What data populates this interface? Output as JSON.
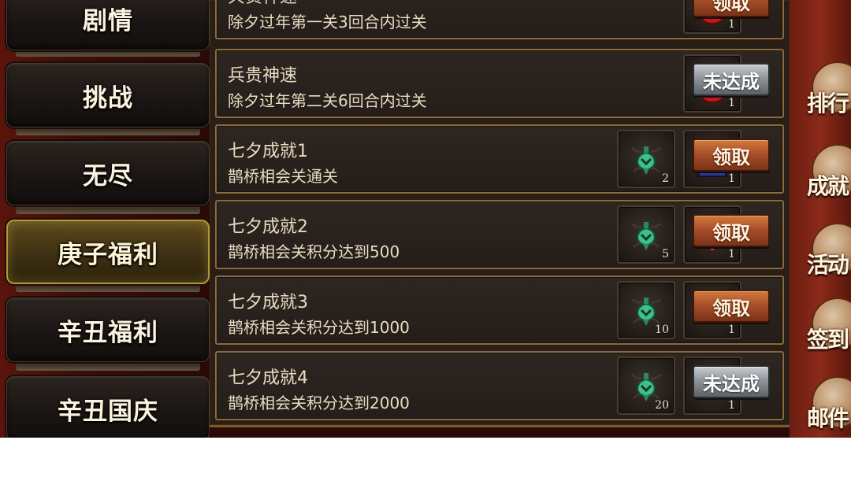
{
  "tabs": [
    {
      "label": "剧情",
      "active": false
    },
    {
      "label": "挑战",
      "active": false
    },
    {
      "label": "无尽",
      "active": false
    },
    {
      "label": "庚子福利",
      "active": true
    },
    {
      "label": "辛丑福利",
      "active": false
    },
    {
      "label": "辛丑国庆",
      "active": false
    }
  ],
  "rows": [
    {
      "title": "兵贵神速",
      "desc": "除夕过年第一关3回合内过关",
      "rewards": [
        {
          "icon": "red-pouch-icon",
          "count": "1"
        }
      ],
      "button": "领取",
      "claimable": true
    },
    {
      "title": "兵贵神速",
      "desc": "除夕过年第二关6回合内过关",
      "rewards": [
        {
          "icon": "red-pouch-icon",
          "count": "1"
        }
      ],
      "button": "未达成",
      "claimable": false
    },
    {
      "title": "七夕成就1",
      "desc": "鹊桥相会关通关",
      "rewards": [
        {
          "icon": "green-jade-icon",
          "count": "2"
        },
        {
          "icon": "warrior-avatar-icon",
          "count": "1"
        }
      ],
      "button": "领取",
      "claimable": true
    },
    {
      "title": "七夕成就2",
      "desc": "鹊桥相会关积分达到500",
      "rewards": [
        {
          "icon": "green-jade-icon",
          "count": "5"
        },
        {
          "icon": "heart-icon",
          "count": "1"
        }
      ],
      "button": "领取",
      "claimable": true
    },
    {
      "title": "七夕成就3",
      "desc": "鹊桥相会关积分达到1000",
      "rewards": [
        {
          "icon": "green-jade-icon",
          "count": "10"
        },
        {
          "icon": "red-book-icon",
          "count": "1"
        }
      ],
      "button": "领取",
      "claimable": true
    },
    {
      "title": "七夕成就4",
      "desc": "鹊桥相会关积分达到2000",
      "rewards": [
        {
          "icon": "green-jade-icon",
          "count": "20"
        },
        {
          "icon": "red-book-icon",
          "count": "1"
        }
      ],
      "button": "未达成",
      "claimable": false
    }
  ],
  "side_menu": [
    {
      "label": "排行",
      "icon": "ranking-icon"
    },
    {
      "label": "成就",
      "icon": "achievement-icon"
    },
    {
      "label": "活动",
      "icon": "event-icon"
    },
    {
      "label": "签到",
      "icon": "signin-icon"
    },
    {
      "label": "邮件",
      "icon": "mail-icon"
    }
  ],
  "colors": {
    "claim_button": "#a9502a",
    "locked_button": "#8f969c",
    "active_tab_border": "#b7982e",
    "row_border": "#8a6a3e"
  }
}
